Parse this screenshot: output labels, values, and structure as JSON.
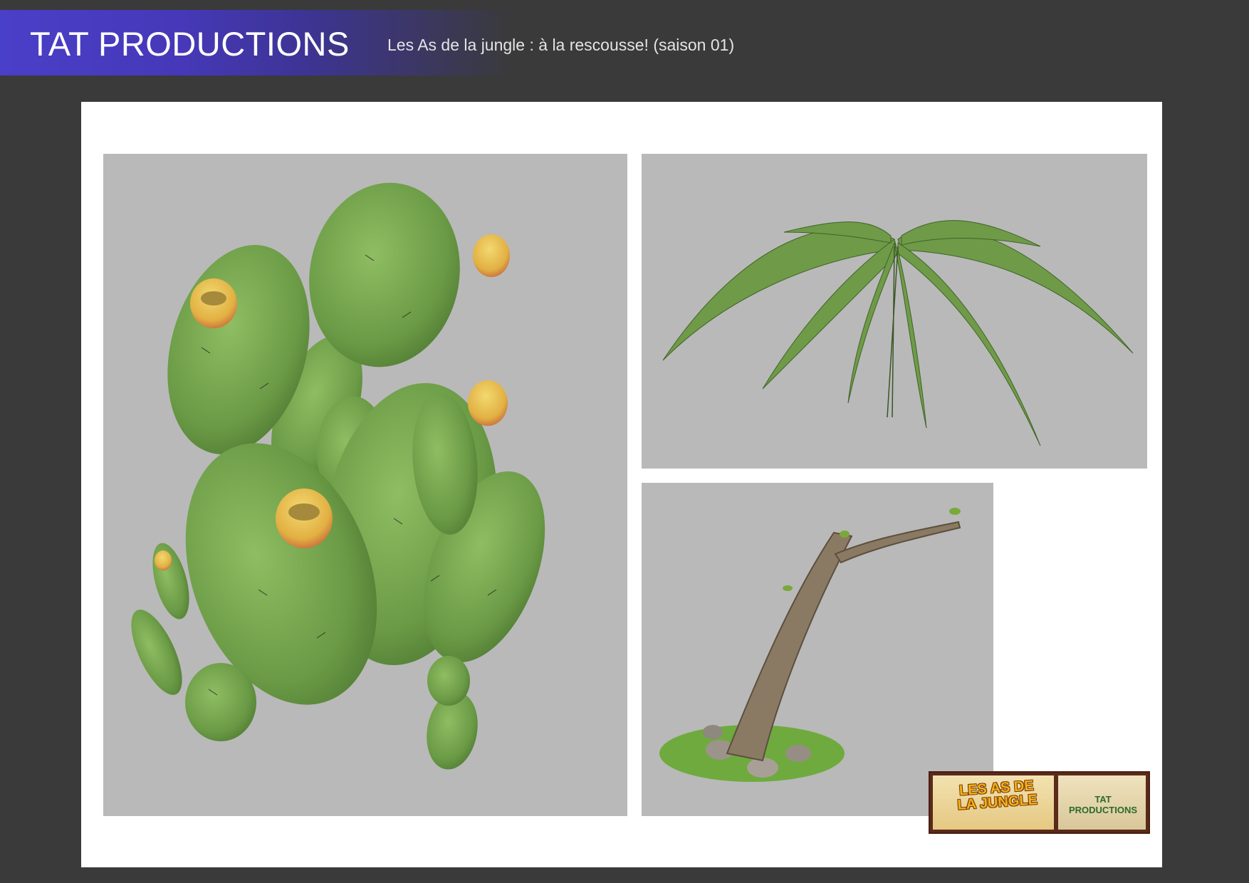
{
  "header": {
    "brand": "TAT PRODUCTIONS",
    "subtitle": "Les As de la jungle : à la rescousse! (saison 01)"
  },
  "panels": [
    {
      "name": "cactus-render",
      "subject": "prickly pear cactus 3D asset"
    },
    {
      "name": "palm-render",
      "subject": "palm fronds 3D asset"
    },
    {
      "name": "tree-render",
      "subject": "leaning tree trunk with grass and stones"
    }
  ],
  "logo": {
    "title": "LES AS DE LA JUNGLE",
    "studio": "TAT PRODUCTIONS"
  },
  "colors": {
    "background": "#3a3a3a",
    "header_accent": "#4a3fc8",
    "sheet": "#ffffff",
    "panel_grey": "#b9b9b9",
    "cactus_green": "#6e9e48",
    "fruit_yellow": "#e8c24a"
  }
}
